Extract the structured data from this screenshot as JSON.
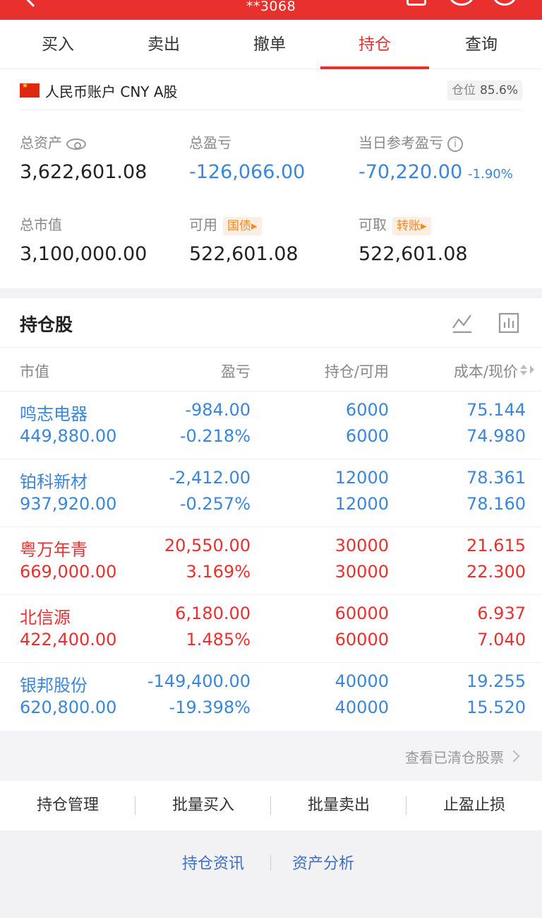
{
  "header": {
    "account_masked": "**3068"
  },
  "tabs": [
    {
      "label": "买入"
    },
    {
      "label": "卖出"
    },
    {
      "label": "撤单"
    },
    {
      "label": "持仓",
      "active": true
    },
    {
      "label": "查询"
    }
  ],
  "account": {
    "name": "人民币账户 CNY A股",
    "position_label": "仓位",
    "position_value": "85.6%"
  },
  "metrics": {
    "total_assets": {
      "label": "总资产",
      "value": "3,622,601.08"
    },
    "total_pnl": {
      "label": "总盈亏",
      "value": "-126,066.00"
    },
    "daily_pnl": {
      "label": "当日参考盈亏",
      "value": "-70,220.00",
      "pct": "-1.90%"
    },
    "market_value": {
      "label": "总市值",
      "value": "3,100,000.00"
    },
    "available": {
      "label": "可用",
      "tag": "国债▸",
      "value": "522,601.08"
    },
    "withdrawable": {
      "label": "可取",
      "tag": "转账▸",
      "value": "522,601.08"
    }
  },
  "holdings": {
    "title": "持仓股",
    "columns": [
      "市值",
      "盈亏",
      "持仓/可用",
      "成本/现价"
    ],
    "rows": [
      {
        "name": "鸣志电器",
        "market_value": "449,880.00",
        "pnl": "-984.00",
        "pnl_pct": "-0.218%",
        "holding": "6000",
        "available": "6000",
        "cost": "75.144",
        "price": "74.980",
        "color": "#3b86d8"
      },
      {
        "name": "铂科新材",
        "market_value": "937,920.00",
        "pnl": "-2,412.00",
        "pnl_pct": "-0.257%",
        "holding": "12000",
        "available": "12000",
        "cost": "78.361",
        "price": "78.160",
        "color": "#3b86d8"
      },
      {
        "name": "粤万年青",
        "market_value": "669,000.00",
        "pnl": "20,550.00",
        "pnl_pct": "3.169%",
        "holding": "30000",
        "available": "30000",
        "cost": "21.615",
        "price": "22.300",
        "color": "#e8312f"
      },
      {
        "name": "北信源",
        "market_value": "422,400.00",
        "pnl": "6,180.00",
        "pnl_pct": "1.485%",
        "holding": "60000",
        "available": "60000",
        "cost": "6.937",
        "price": "7.040",
        "color": "#e8312f"
      },
      {
        "name": "银邦股份",
        "market_value": "620,800.00",
        "pnl": "-149,400.00",
        "pnl_pct": "-19.398%",
        "holding": "40000",
        "available": "40000",
        "cost": "19.255",
        "price": "15.520",
        "color": "#3b86d8"
      }
    ]
  },
  "cleared_link": "查看已清仓股票",
  "actions": [
    "持仓管理",
    "批量买入",
    "批量卖出",
    "止盈止损"
  ],
  "footer_links": [
    "持仓资讯",
    "资产分析"
  ]
}
